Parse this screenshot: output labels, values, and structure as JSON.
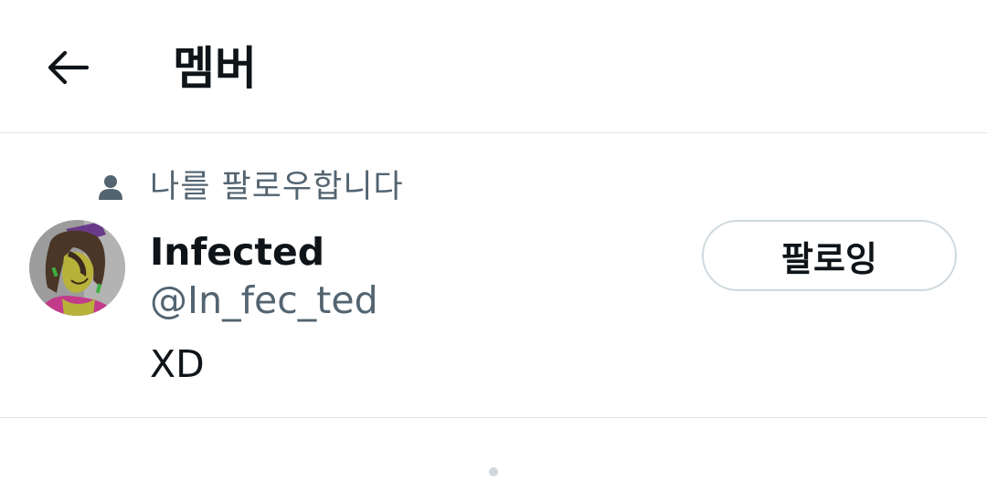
{
  "header": {
    "back_icon": "arrow-left-icon",
    "title": "멤버"
  },
  "member": {
    "social_context_icon": "person-icon",
    "social_context": "나를 팔로우합니다",
    "name": "Infected",
    "handle": "@In_fec_ted",
    "bio": "XD",
    "follow_button_label": "팔로잉"
  },
  "colors": {
    "primary_text": "#0f1419",
    "secondary_text": "#536471",
    "border": "#cfd9de",
    "divider": "#dfe3e6"
  }
}
